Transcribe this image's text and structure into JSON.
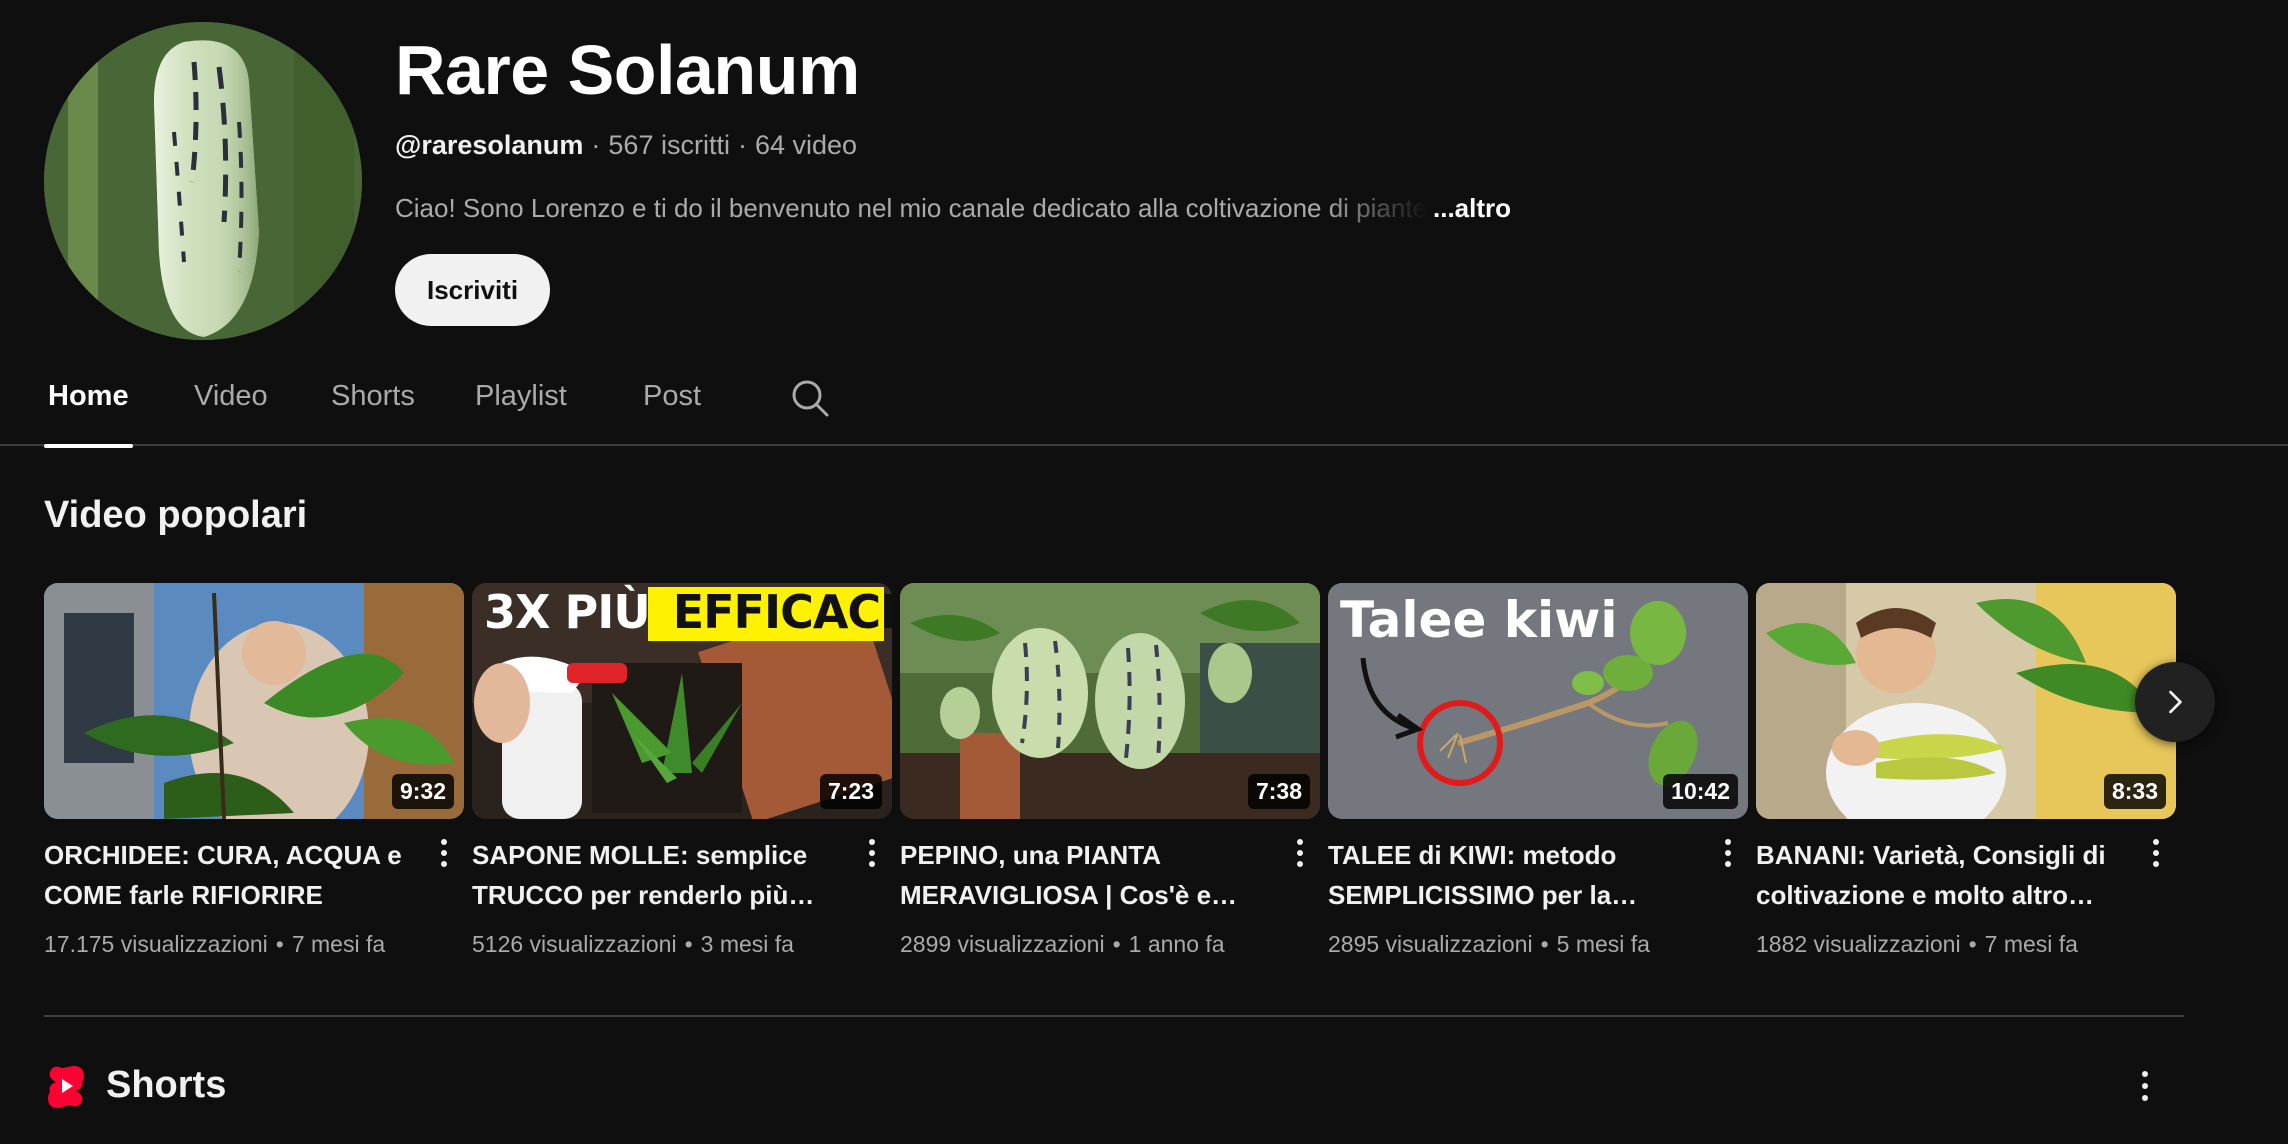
{
  "channel": {
    "name": "Rare Solanum",
    "handle": "@raresolanum",
    "subscribers": "567 iscritti",
    "video_count": "64 video",
    "description": "Ciao! Sono Lorenzo e ti do il benvenuto nel mio canale dedicato alla coltivazione di piante",
    "more_label": "...altro",
    "subscribe_label": "Iscriviti",
    "avatar_icon": "pepino-fruit-avatar"
  },
  "tabs": [
    {
      "label": "Home",
      "active": true
    },
    {
      "label": "Video",
      "active": false
    },
    {
      "label": "Shorts",
      "active": false
    },
    {
      "label": "Playlist",
      "active": false
    },
    {
      "label": "Post",
      "active": false
    }
  ],
  "search_icon": "search-icon",
  "popular": {
    "title": "Video popolari",
    "videos": [
      {
        "title": "ORCHIDEE: CURA, ACQUA e COME farle RIFIORIRE",
        "duration": "9:32",
        "views": "17.175 visualizzazioni",
        "age": "7 mesi fa"
      },
      {
        "title": "SAPONE MOLLE: semplice TRUCCO per renderlo più…",
        "duration": "7:23",
        "views": "5126 visualizzazioni",
        "age": "3 mesi fa",
        "thumb_text_1": "3X PIÙ",
        "thumb_text_2": "EFFICACE!"
      },
      {
        "title": "PEPINO, una PIANTA MERAVIGLIOSA | Cos'è e…",
        "duration": "7:38",
        "views": "2899 visualizzazioni",
        "age": "1 anno fa"
      },
      {
        "title": "TALEE di KIWI: metodo SEMPLICISSIMO per la…",
        "duration": "10:42",
        "views": "2895 visualizzazioni",
        "age": "5 mesi fa",
        "thumb_text_1": "Talee kiwi"
      },
      {
        "title": "BANANI: Varietà, Consigli di coltivazione e molto altro…",
        "duration": "8:33",
        "views": "1882 visualizzazioni",
        "age": "7 mesi fa"
      }
    ]
  },
  "shorts": {
    "title": "Shorts",
    "icon": "youtube-shorts-icon"
  },
  "colors": {
    "background": "#0f0f0f",
    "text_primary": "#f1f1f1",
    "text_secondary": "#aaaaaa",
    "shorts_red": "#ff0033",
    "subscribe_bg": "#f1f1f1"
  }
}
